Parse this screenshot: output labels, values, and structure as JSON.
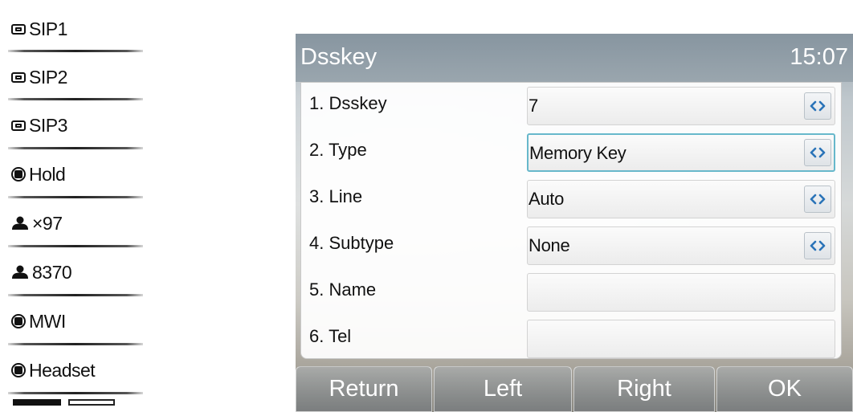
{
  "dss_panel": {
    "items": [
      {
        "icon": "sip-line-icon",
        "label": "SIP1"
      },
      {
        "icon": "sip-line-icon",
        "label": "SIP2"
      },
      {
        "icon": "sip-line-icon",
        "label": "SIP3"
      },
      {
        "icon": "function-key-icon",
        "label": "Hold"
      },
      {
        "icon": "contact-icon",
        "label": "×97"
      },
      {
        "icon": "contact-icon",
        "label": "8370"
      },
      {
        "icon": "function-key-icon",
        "label": "MWI"
      },
      {
        "icon": "function-key-icon",
        "label": "Headset"
      }
    ],
    "page_count": 2,
    "current_page": 1
  },
  "screen": {
    "title": "Dsskey",
    "time": "15:07",
    "rows": [
      {
        "label": "1.  Dsskey",
        "value": "7",
        "has_selector": true
      },
      {
        "label": "2.  Type",
        "value": "Memory Key",
        "has_selector": true
      },
      {
        "label": "3.  Line",
        "value": "Auto",
        "has_selector": true
      },
      {
        "label": "4.  Subtype",
        "value": "None",
        "has_selector": true
      },
      {
        "label": "5.  Name",
        "value": "",
        "has_selector": false
      },
      {
        "label": "6.  Tel",
        "value": "",
        "has_selector": false
      }
    ],
    "selector_glyph": "‹›",
    "softkeys": [
      "Return",
      "Left",
      "Right",
      "OK"
    ]
  },
  "colors": {
    "title_bar": "#8f9ca5",
    "focus_border": "#67b8cb",
    "arrow_color": "#2a73b8"
  }
}
